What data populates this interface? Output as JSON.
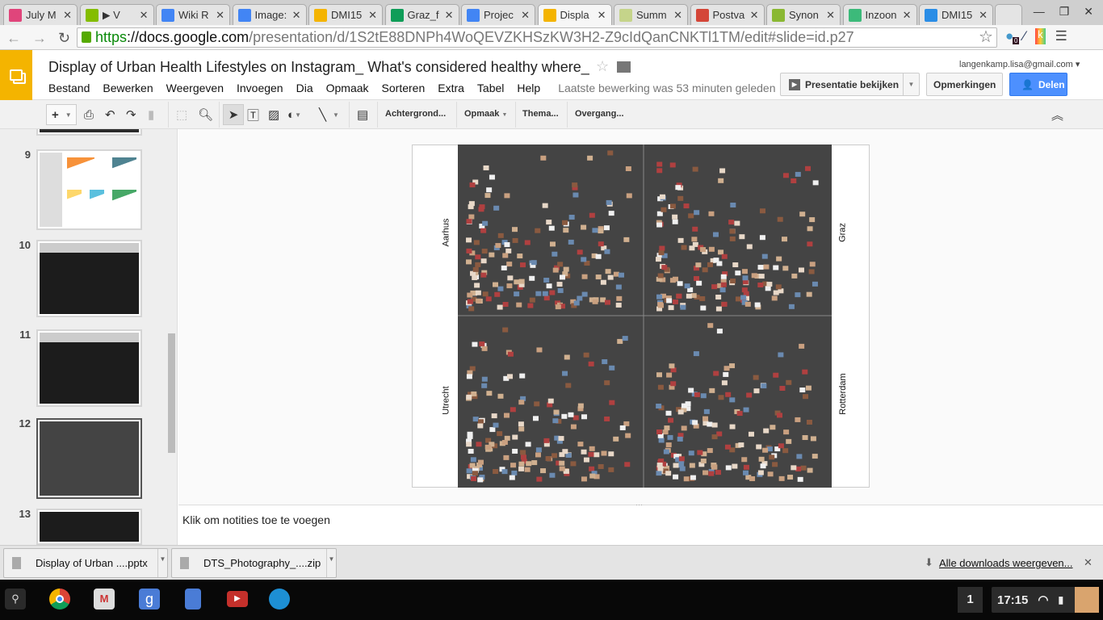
{
  "browser": {
    "tabs": [
      {
        "title": "July M",
        "icon": "blog25-icon",
        "color": "#e0457b"
      },
      {
        "title": "▶ V",
        "icon": "spotify-icon",
        "color": "#84bd00"
      },
      {
        "title": "Wiki R",
        "icon": "docs-icon",
        "color": "#4285f4"
      },
      {
        "title": "Image:",
        "icon": "docs-icon",
        "color": "#4285f4"
      },
      {
        "title": "DMI15",
        "icon": "drive-icon",
        "color": "#f4b400"
      },
      {
        "title": "Graz_f",
        "icon": "sheets-icon",
        "color": "#0f9d58"
      },
      {
        "title": "Projec",
        "icon": "docs-icon",
        "color": "#4285f4"
      },
      {
        "title": "Displa",
        "icon": "slides-icon",
        "color": "#f4b400",
        "active": true
      },
      {
        "title": "Summ",
        "icon": "page-icon",
        "color": "#c5d48a"
      },
      {
        "title": "Postva",
        "icon": "gmail-icon",
        "color": "#d44638"
      },
      {
        "title": "Synon",
        "icon": "synonym-icon",
        "color": "#8ab833"
      },
      {
        "title": "Inzoon",
        "icon": "e-icon",
        "color": "#3cba7a"
      },
      {
        "title": "DMI15",
        "icon": "dropbox-icon",
        "color": "#2a8de6"
      }
    ],
    "url_scheme": "https",
    "url_host": "://docs.google.com",
    "url_path": "/presentation/d/1S2tE88DNPh4WoQEVZKHSzKW3H2-Z9cIdQanCNKTl1TM/edit#slide=id.p27",
    "ext_badge": "0"
  },
  "doc": {
    "title": "Display of Urban Health Lifestyles on Instagram_ What's considered healthy where_",
    "menu": [
      "Bestand",
      "Bewerken",
      "Weergeven",
      "Invoegen",
      "Dia",
      "Opmaak",
      "Sorteren",
      "Extra",
      "Tabel",
      "Help"
    ],
    "last_edit": "Laatste bewerking was 53 minuten geleden",
    "account": "langenkamp.lisa@gmail.com",
    "present": "Presentatie bekijken",
    "comments": "Opmerkingen",
    "share": "Delen",
    "toolbar": {
      "background": "Achtergrond...",
      "layout": "Opmaak",
      "theme": "Thema...",
      "transition": "Overgang..."
    }
  },
  "slides": [
    {
      "num": "9"
    },
    {
      "num": "10"
    },
    {
      "num": "11"
    },
    {
      "num": "12",
      "selected": true
    },
    {
      "num": "13"
    }
  ],
  "slide": {
    "cities": [
      "Aarhus",
      "Graz",
      "Utrecht",
      "Rotterdam"
    ]
  },
  "notes": "Klik om notities toe te voegen",
  "downloads": {
    "items": [
      "Display of Urban ....pptx",
      "DTS_Photography_....zip"
    ],
    "show_all": "Alle downloads weergeven..."
  },
  "shelf": {
    "notifications": "1",
    "time": "17:15"
  }
}
